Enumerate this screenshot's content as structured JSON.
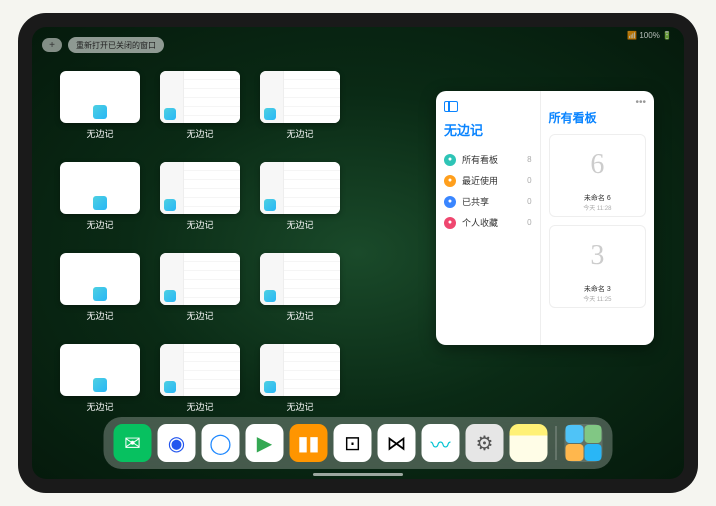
{
  "status": {
    "text": "📶 100% 🔋"
  },
  "top": {
    "plus": "+",
    "reopen_label": "重新打开已关闭的窗口"
  },
  "windows": {
    "label": "无边记",
    "items": [
      {
        "type": "blank"
      },
      {
        "type": "grid"
      },
      {
        "type": "grid"
      },
      {
        "type": "blank"
      },
      {
        "type": "grid"
      },
      {
        "type": "grid"
      },
      {
        "type": "blank"
      },
      {
        "type": "grid"
      },
      {
        "type": "grid"
      },
      {
        "type": "blank"
      },
      {
        "type": "grid"
      },
      {
        "type": "grid"
      }
    ]
  },
  "panel": {
    "title": "无边记",
    "right_title": "所有看板",
    "sidebar": [
      {
        "icon_color": "#2ec4b6",
        "label": "所有看板",
        "count": "8"
      },
      {
        "icon_color": "#ff9f1c",
        "label": "最近使用",
        "count": "0"
      },
      {
        "icon_color": "#3a86ff",
        "label": "已共享",
        "count": "0"
      },
      {
        "icon_color": "#ef476f",
        "label": "个人收藏",
        "count": "0"
      }
    ],
    "boards": [
      {
        "sketch": "6",
        "name": "未命名 6",
        "date": "今天 11:28"
      },
      {
        "sketch": "3",
        "name": "未命名 3",
        "date": "今天 11:25"
      }
    ]
  },
  "dock": {
    "items": [
      {
        "name": "wechat",
        "bg": "#07c160",
        "glyph": "✉",
        "glyph_color": "#fff"
      },
      {
        "name": "quark",
        "bg": "#ffffff",
        "glyph": "◉",
        "glyph_color": "#2255ee"
      },
      {
        "name": "qqbrowser",
        "bg": "#ffffff",
        "glyph": "◯",
        "glyph_color": "#1e88ff"
      },
      {
        "name": "play",
        "bg": "#ffffff",
        "glyph": "▶",
        "glyph_color": "#34a853"
      },
      {
        "name": "books",
        "bg": "#ff9500",
        "glyph": "▮▮",
        "glyph_color": "#fff"
      },
      {
        "name": "dice",
        "bg": "#ffffff",
        "glyph": "⊡",
        "glyph_color": "#000"
      },
      {
        "name": "connect",
        "bg": "#ffffff",
        "glyph": "⋈",
        "glyph_color": "#000"
      },
      {
        "name": "freeform",
        "bg": "#ffffff",
        "glyph": "〰",
        "glyph_color": "#00c2d1"
      },
      {
        "name": "settings",
        "bg": "#e6e6e6",
        "glyph": "⚙",
        "glyph_color": "#555"
      },
      {
        "name": "notes",
        "bg": "linear-gradient(#fff176 30%, #fffde7 30%)",
        "glyph": "",
        "glyph_color": ""
      }
    ]
  }
}
